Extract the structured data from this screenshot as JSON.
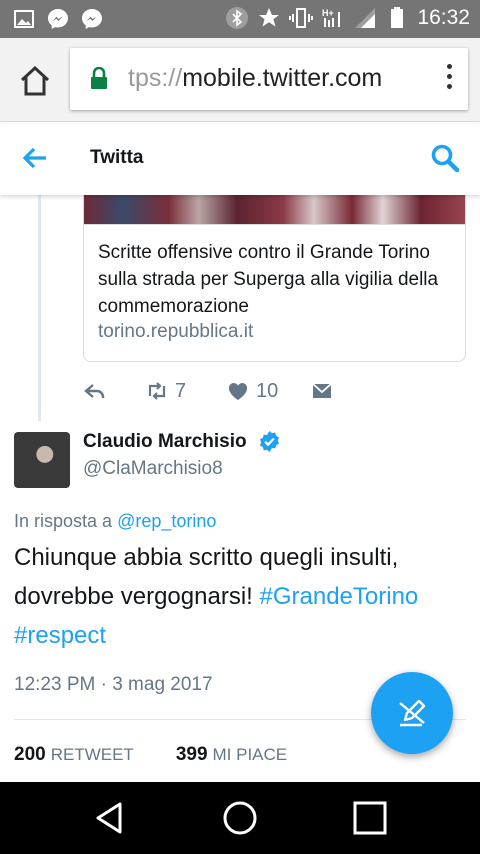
{
  "status_bar": {
    "time": "16:32",
    "left_icons": [
      "image-icon",
      "messenger-icon",
      "messenger-icon"
    ],
    "right_icons": [
      "bluetooth-icon",
      "star-icon",
      "vibrate-icon",
      "hplus-signal-icon",
      "signal-icon",
      "battery-icon"
    ]
  },
  "browser": {
    "url_prefix": "tps://",
    "url_host": "mobile.twitter.com"
  },
  "header": {
    "title": "Twitta"
  },
  "card": {
    "title": "Scritte offensive contro il Grande Torino sulla strada per Superga alla vigilia della commemorazione",
    "domain": "torino.repubblica.it"
  },
  "parent_actions": {
    "retweets": "7",
    "likes": "10"
  },
  "tweet": {
    "author_name": "Claudio Marchisio",
    "author_handle": "@ClaMarchisio8",
    "reply_prefix": "In risposta a",
    "reply_handle": "@rep_torino",
    "text": "Chiunque abbia scritto quegli insulti, dovrebbe vergognarsi!",
    "hashtag1": "#GrandeTorino",
    "hashtag2": "#respect",
    "timestamp": "12:23 PM · 3 mag 2017",
    "retweet_count": "200",
    "retweet_label": "RETWEET",
    "like_count": "399",
    "like_label": "MI PIACE"
  },
  "colors": {
    "accent": "#1da1f2",
    "status_bar": "#757575",
    "secure_lock": "#0b8043"
  }
}
